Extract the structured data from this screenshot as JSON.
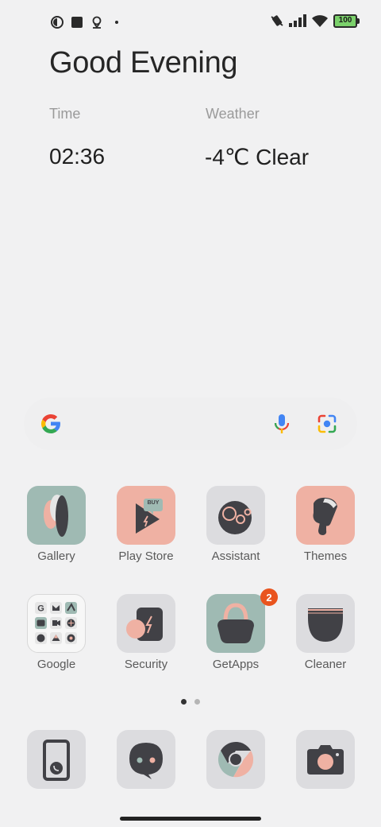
{
  "status_bar": {
    "left_icons": [
      "app-notification-icon",
      "square-notification-icon",
      "location-icon",
      "more-dot-icon"
    ],
    "right_icons": [
      "vibrate-icon",
      "signal-icon",
      "wifi-icon",
      "battery-icon"
    ],
    "battery": "100"
  },
  "widget": {
    "greeting": "Good Evening",
    "time_label": "Time",
    "time_value": "02:36",
    "weather_label": "Weather",
    "weather_value": "-4℃ Clear"
  },
  "search": {
    "icons": [
      "google-g-icon",
      "mic-icon",
      "lens-icon"
    ]
  },
  "apps": [
    {
      "label": "Gallery"
    },
    {
      "label": "Play Store",
      "sign": "BUY"
    },
    {
      "label": "Assistant"
    },
    {
      "label": "Themes"
    },
    {
      "label": "Google"
    },
    {
      "label": "Security"
    },
    {
      "label": "GetApps",
      "badge": "2"
    },
    {
      "label": "Cleaner"
    }
  ],
  "dock": [
    "phone-icon",
    "messages-icon",
    "chrome-icon",
    "camera-icon"
  ],
  "page_indicator": {
    "pages": 2,
    "active": 1
  },
  "colors": {
    "background": "#f1f1f2",
    "tile_gray": "#dcdcdf",
    "tile_teal": "#9fbab3",
    "tile_pink": "#efb1a3",
    "icon_dark": "#414146",
    "badge": "#e9541e"
  }
}
